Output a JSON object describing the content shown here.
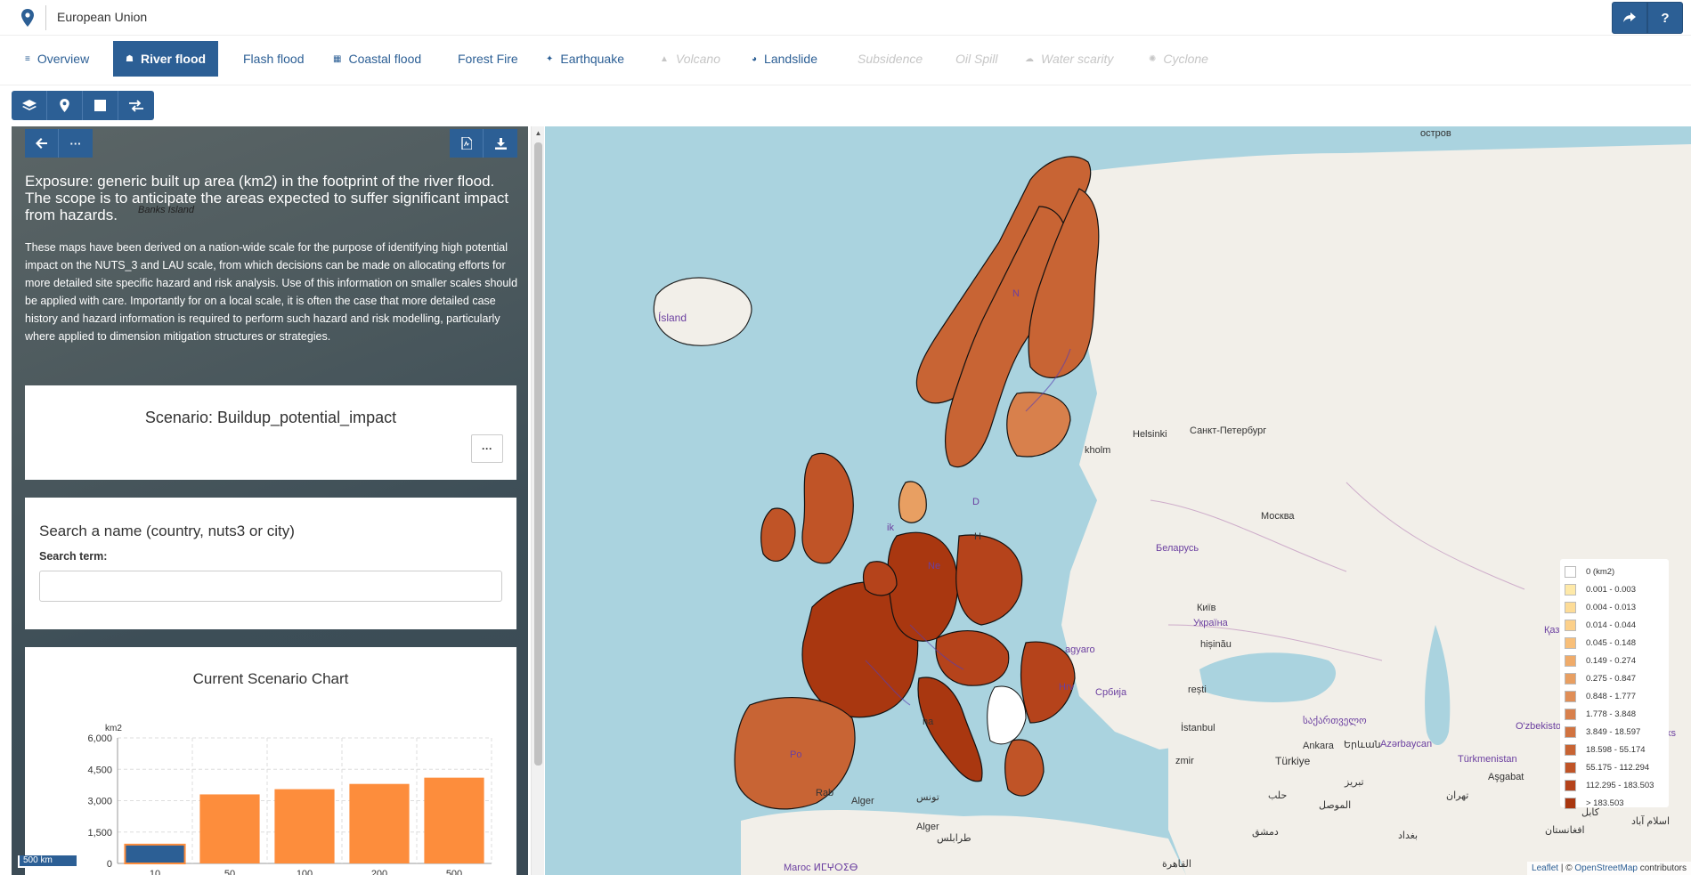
{
  "header": {
    "region": "European Union",
    "share_icon": "share-icon",
    "help_label": "?"
  },
  "tabs": [
    {
      "label": "Overview",
      "icon": "list-icon",
      "active": false,
      "disabled": false
    },
    {
      "label": "River flood",
      "icon": "river-flood-icon",
      "active": true,
      "disabled": false
    },
    {
      "label": "Flash flood",
      "icon": "",
      "active": false,
      "disabled": false
    },
    {
      "label": "Coastal flood",
      "icon": "coastal-flood-icon",
      "active": false,
      "disabled": false
    },
    {
      "label": "Forest Fire",
      "icon": "",
      "active": false,
      "disabled": false
    },
    {
      "label": "Earthquake",
      "icon": "earthquake-icon",
      "active": false,
      "disabled": false
    },
    {
      "label": "Volcano",
      "icon": "volcano-icon",
      "active": false,
      "disabled": true
    },
    {
      "label": "Landslide",
      "icon": "landslide-icon",
      "active": false,
      "disabled": false
    },
    {
      "label": "Subsidence",
      "icon": "",
      "active": false,
      "disabled": true
    },
    {
      "label": "Oil Spill",
      "icon": "",
      "active": false,
      "disabled": true
    },
    {
      "label": "Water scarity",
      "icon": "water-scarcity-icon",
      "active": false,
      "disabled": true
    },
    {
      "label": "Cyclone",
      "icon": "cyclone-icon",
      "active": false,
      "disabled": true
    }
  ],
  "panel": {
    "title": "Exposure: generic built up area (km2) in the footprint of the river flood. The scope is to anticipate the areas expected to suffer significant impact from hazards.",
    "description": "These maps have been derived on a nation-wide scale for the purpose of identifying high potential impact on the NUTS_3 and LAU scale, from which decisions can be made on allocating efforts for more detailed site specific hazard and risk analysis. Use of this information on smaller scales should be applied with care. Importantly for on a local scale, it is often the case that more detailed case history and hazard information is required to perform such hazard and risk modelling, particularly where applied to dimension mitigation structures or strategies.",
    "bg_label": "Banks Island",
    "more_label": "···",
    "scenario_title": "Scenario: Buildup_potential_impact",
    "scenario_more": "···",
    "search_title": "Search a name (country, nuts3 or city)",
    "search_label": "Search term:",
    "search_value": "",
    "chart_title": "Current Scenario Chart",
    "scale_bar": "500 km"
  },
  "chart_data": {
    "type": "bar",
    "title": "Current Scenario Chart",
    "ylabel": "km2",
    "categories": [
      "10",
      "50",
      "100",
      "200",
      "500"
    ],
    "values": [
      900,
      3300,
      3550,
      3800,
      4100
    ],
    "ylim": [
      0,
      6000
    ],
    "yticks": [
      "0",
      "1,500",
      "3,000",
      "4,500",
      "6,000"
    ],
    "ytick_values": [
      0,
      1500,
      3000,
      4500,
      6000
    ],
    "colors": [
      "#2c5f95",
      "#fd8d3c",
      "#fd8d3c",
      "#fd8d3c",
      "#fd8d3c"
    ],
    "grid": true
  },
  "map": {
    "labels": {
      "iceland": "Ísland",
      "moscow": "Москва",
      "belarus": "Беларусь",
      "ukraine": "Україна",
      "kyiv": "Київ",
      "spb": "Санкт-Петербург",
      "helsinki": "Helsinki",
      "stockholm": "kholm",
      "istanbul": "İstanbul",
      "turkey": "Türkiye",
      "georgia": "საქართველო",
      "armenia": "Երևան",
      "azerbaijan": "Azərbaycan",
      "turkmen": "Türkmenistan",
      "uzbek": "O'zbekisto",
      "algeria": "Alger",
      "tunis": "تونس",
      "tripoli": "طرابلس",
      "cairo": "القاهرة",
      "baghdad": "بغداد",
      "tehran": "تهران",
      "damascus": "دمشق",
      "ashgabat": "Aşgabat",
      "kabul": "کابل",
      "islamabad": "اسلام آباد",
      "morocco": "Maroc ⵍⵎⵖⵔⵉⴱ",
      "rabat": "Rab",
      "island_top": "остров",
      "kazakh": "Қаз",
      "belgrade": "Србија",
      "hungary": "agyaro",
      "croatia": "Hrv",
      "bucharest": "rești",
      "chisinau": "hișinău",
      "afghan": "افغانستان",
      "norway_n": "N",
      "uk": "ik",
      "nl": "Ne",
      "dk": "D",
      "H": "H",
      "po": "Po",
      "rome": "na",
      "izmir": "zmir",
      "tabr": "تبریز",
      "aleppo": "حلب",
      "mosul": "الموصل",
      "ankara": "Ankara",
      "ks": "ks"
    }
  },
  "legend": [
    {
      "label": "0 (km2)",
      "color": "#ffffff"
    },
    {
      "label": "0.001 - 0.003",
      "color": "#fee9a8"
    },
    {
      "label": "0.004 - 0.013",
      "color": "#fddc97"
    },
    {
      "label": "0.014 - 0.044",
      "color": "#fcd08a"
    },
    {
      "label": "0.045 - 0.148",
      "color": "#f8bf79"
    },
    {
      "label": "0.149 - 0.274",
      "color": "#efab6a"
    },
    {
      "label": "0.275 - 0.847",
      "color": "#e89f62"
    },
    {
      "label": "0.848 - 1.777",
      "color": "#e08e57"
    },
    {
      "label": "1.778 - 3.848",
      "color": "#d8804c"
    },
    {
      "label": "3.849 - 18.597",
      "color": "#d17340"
    },
    {
      "label": "18.598 - 55.174",
      "color": "#c86434"
    },
    {
      "label": "55.175 - 112.294",
      "color": "#c05427"
    },
    {
      "label": "112.295 - 183.503",
      "color": "#b5431b"
    },
    {
      "label": "> 183.503",
      "color": "#a93710"
    }
  ],
  "attribution": {
    "leaflet": "Leaflet",
    "sep": " | © ",
    "osm": "OpenStreetMap",
    "contrib": " contributors"
  },
  "colors": {
    "primary": "#2c5f95",
    "bar_orange": "#fd8d3c",
    "sea": "#aad3df",
    "land": "#f2efe9"
  }
}
